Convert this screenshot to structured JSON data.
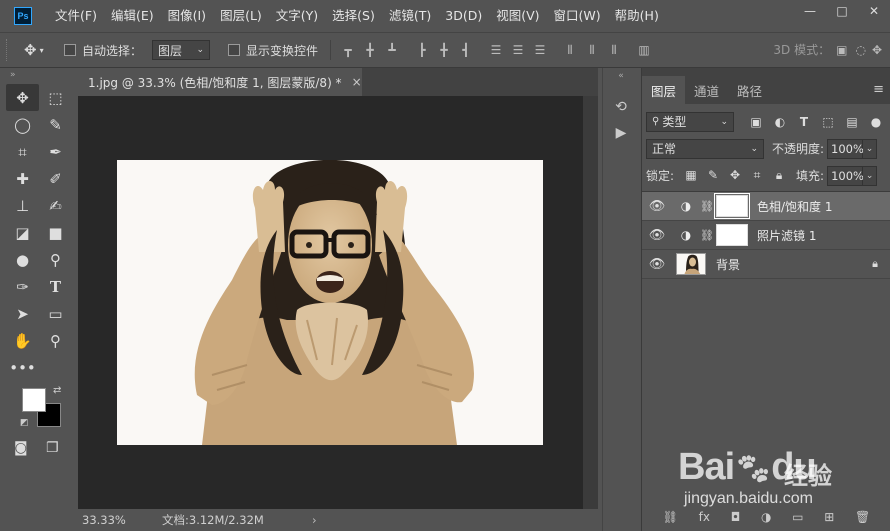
{
  "app": {
    "logo": "Ps"
  },
  "menu": [
    "文件(F)",
    "编辑(E)",
    "图像(I)",
    "图层(L)",
    "文字(Y)",
    "选择(S)",
    "滤镜(T)",
    "3D(D)",
    "视图(V)",
    "窗口(W)",
    "帮助(H)"
  ],
  "window_controls": {
    "minimize": "—",
    "maximize": "□",
    "close": "✕"
  },
  "options": {
    "auto_select_label": "自动选择：",
    "auto_select_target": "图层",
    "show_transform_label": "显示变换控件",
    "mode_3d_label": "3D 模式："
  },
  "document": {
    "tab_title": "1.jpg @ 33.3% (色相/饱和度 1, 图层蒙版/8) *",
    "close": "×"
  },
  "status": {
    "zoom": "33.33%",
    "doc_size": "文档:3.12M/2.32M",
    "arrow": "›"
  },
  "layers_panel": {
    "tabs": [
      "图层",
      "通道",
      "路径"
    ],
    "active_tab": "图层",
    "filter_label": "类型",
    "blend_mode": "正常",
    "opacity_label": "不透明度:",
    "opacity_value": "100%",
    "lock_label": "锁定:",
    "fill_label": "填充:",
    "fill_value": "100%",
    "layers": [
      {
        "name": "色相/饱和度 1",
        "type": "adjustment",
        "selected": true
      },
      {
        "name": "照片滤镜 1",
        "type": "adjustment",
        "selected": false
      },
      {
        "name": "背景",
        "type": "background",
        "locked": true
      }
    ]
  },
  "watermark": {
    "brand": "Bai",
    "brand2": "du",
    "cn": "经验",
    "url": "jingyan.baidu.com"
  },
  "colors": {
    "foreground": "#ffffff",
    "background": "#000000",
    "sepia": "#d9bd94"
  }
}
